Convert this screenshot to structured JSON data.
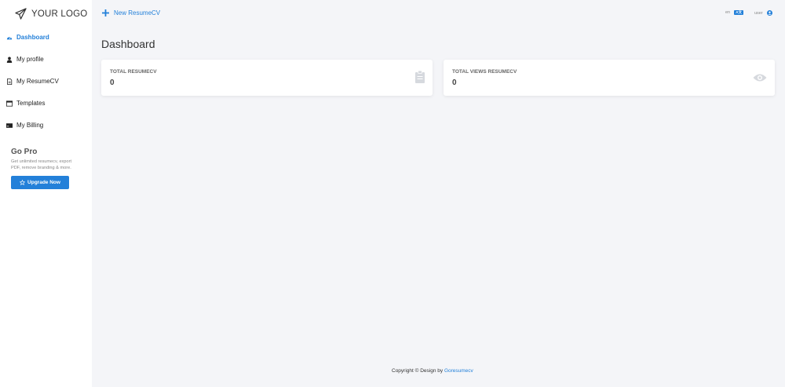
{
  "logo": {
    "text": "YOUR LOGO"
  },
  "sidebar": {
    "items": [
      {
        "label": "Dashboard"
      },
      {
        "label": "My profile"
      },
      {
        "label": "My ResumeCV"
      },
      {
        "label": "Templates"
      },
      {
        "label": "My Billing"
      }
    ]
  },
  "gopro": {
    "title": "Go Pro",
    "description": "Get unlimited resumecv, export PDF, remove branding & more.",
    "button_label": "Upgrade Now"
  },
  "topbar": {
    "new_label": "New ResumeCV",
    "language": "en",
    "language_badge": "A文",
    "user": "user"
  },
  "main": {
    "title": "Dashboard",
    "cards": [
      {
        "label": "TOTAL RESUMECV",
        "value": "0"
      },
      {
        "label": "TOTAL VIEWS RESUMECV",
        "value": "0"
      }
    ]
  },
  "footer": {
    "text": "Copyright © Design by",
    "link": "Goresumecv"
  },
  "colors": {
    "accent": "#2380d9",
    "background": "#f4f5f8",
    "sidebar": "#ffffff"
  }
}
